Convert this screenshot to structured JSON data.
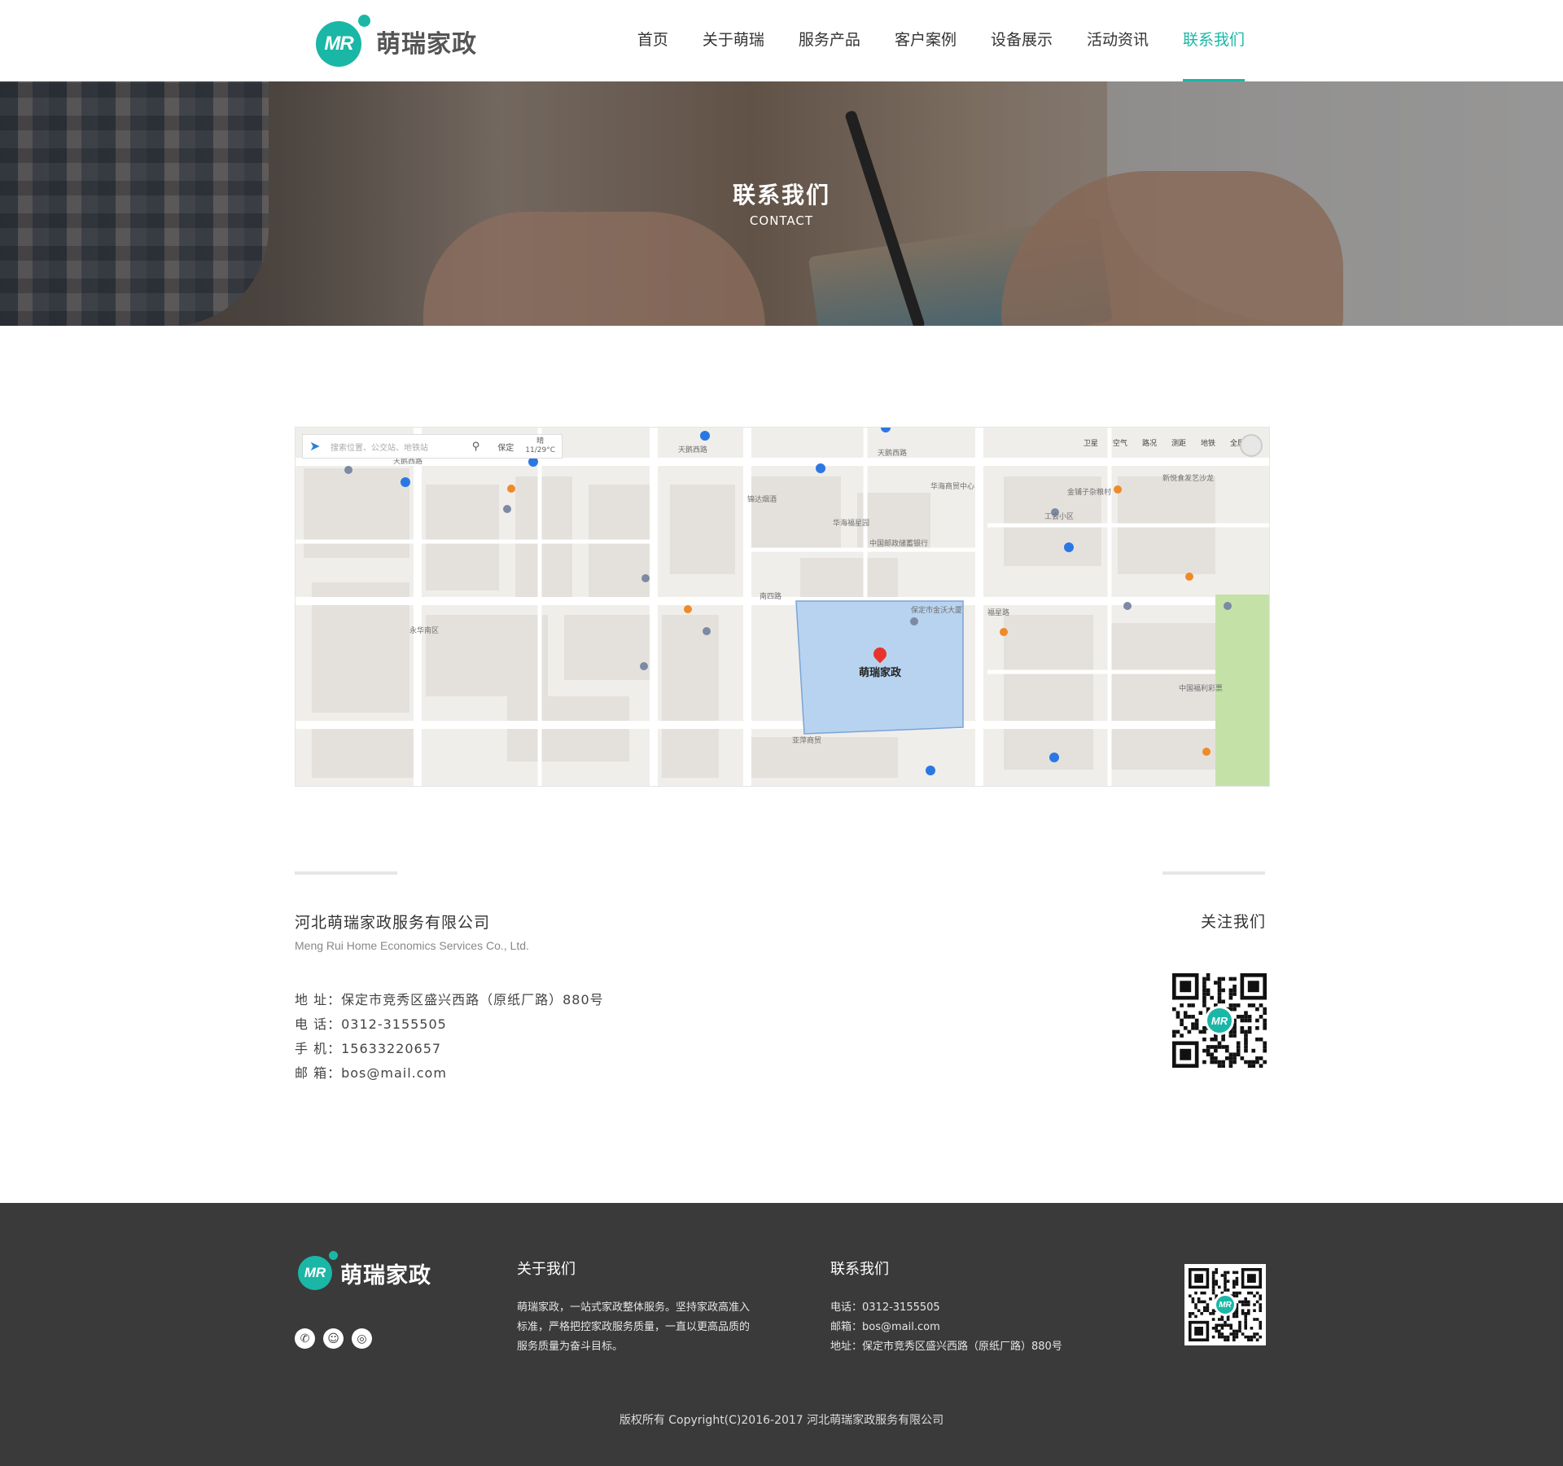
{
  "brand": {
    "name": "萌瑞家政",
    "mark": "MR"
  },
  "nav": {
    "items": [
      {
        "label": "首页"
      },
      {
        "label": "关于萌瑞"
      },
      {
        "label": "服务产品"
      },
      {
        "label": "客户案例"
      },
      {
        "label": "设备展示"
      },
      {
        "label": "活动资讯"
      },
      {
        "label": "联系我们",
        "active": true
      }
    ]
  },
  "banner": {
    "title": "联系我们",
    "subtitle": "CONTACT"
  },
  "map": {
    "search_placeholder": "搜索位置、公交站、地铁站",
    "city": "保定",
    "weather_label": "晴",
    "weather_temp": "11/29°C",
    "tools": [
      "卫星",
      "空气",
      "路况",
      "测距",
      "地铁",
      "全屏"
    ],
    "pin_label": "萌瑞家政",
    "roads": [
      "天鹅西路",
      "天鹅西路",
      "天鹅西路",
      "南四路",
      "福星路",
      "华海福星园",
      "中国邮政储蓄银行",
      "保定市金沃大厦",
      "工会小区",
      "新悦食发艺沙龙",
      "华海商贸中心",
      "永华南区",
      "锦达烟酒",
      "萌瑞家政",
      "亚萍商贸",
      "中国福利彩票",
      "金铺子杂粮村"
    ]
  },
  "contact": {
    "company_name": "河北萌瑞家政服务有限公司",
    "company_en": "Meng Rui Home Economics Services Co., Ltd.",
    "address_label": "地 址：",
    "address": "保定市竞秀区盛兴西路（原纸厂路）880号",
    "phone_label": "电 话：",
    "phone": "0312-3155505",
    "mobile_label": "手 机：",
    "mobile": "15633220657",
    "email_label": "邮 箱：",
    "email": "bos@mail.com",
    "follow_title": "关注我们"
  },
  "footer": {
    "about_title": "关于我们",
    "about_text_1": "萌瑞家政，一站式家政整体服务。坚持家政高准入",
    "about_text_2": "标准，严格把控家政服务质量，一直以更高品质的",
    "about_text_3": "服务质量为奋斗目标。",
    "contact_title": "联系我们",
    "phone": "电话：0312-3155505",
    "email": "邮箱：bos@mail.com",
    "address": "地址：保定市竞秀区盛兴西路（原纸厂路）880号",
    "copyright": "版权所有 Copyright(C)2016-2017 河北萌瑞家政服务有限公司"
  },
  "colors": {
    "accent": "#1bb7a6",
    "footer_bg": "#3a3a3a",
    "map_highlight": "#b8d3f0"
  }
}
